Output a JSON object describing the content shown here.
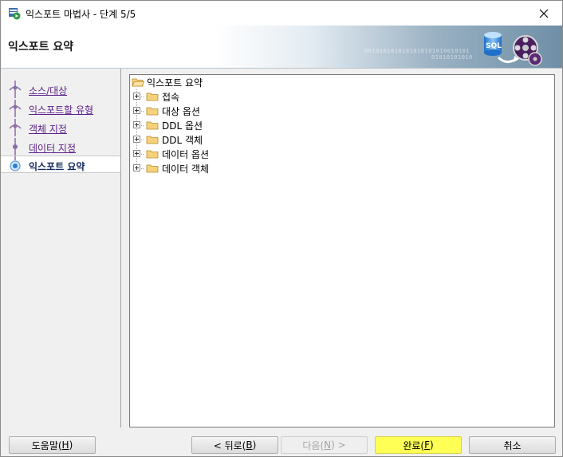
{
  "window": {
    "title": "익스포트 마법사 - 단계 5/5"
  },
  "banner": {
    "title": "익스포트 요약",
    "bits": "0010101010101010101010010101",
    "bits2": "01010101010",
    "graphic_text": "SQL"
  },
  "nav": {
    "items": [
      {
        "label": "소스/대상",
        "state": "done"
      },
      {
        "label": "익스포트할 유형",
        "state": "done"
      },
      {
        "label": "객체 지정",
        "state": "done"
      },
      {
        "label": "데이터 지정",
        "state": "done"
      },
      {
        "label": "익스포트 요약",
        "state": "active"
      }
    ]
  },
  "tree": {
    "root": {
      "label": "익스포트 요약",
      "icon": "open-folder-icon"
    },
    "children": [
      {
        "label": "접속",
        "icon": "folder-icon"
      },
      {
        "label": "대상 옵션",
        "icon": "folder-icon"
      },
      {
        "label": "DDL 옵션",
        "icon": "folder-icon"
      },
      {
        "label": "DDL 객체",
        "icon": "folder-icon"
      },
      {
        "label": "데이터 옵션",
        "icon": "folder-icon"
      },
      {
        "label": "데이터 객체",
        "icon": "folder-icon"
      }
    ]
  },
  "buttons": {
    "help": {
      "label": "도움말(",
      "mnemonic": "H",
      "tail": ")"
    },
    "back": {
      "label": "< 뒤로(",
      "mnemonic": "B",
      "tail": ")"
    },
    "next": {
      "label": "다음(",
      "mnemonic": "N",
      "tail": ") >"
    },
    "finish": {
      "label": "완료(",
      "mnemonic": "F",
      "tail": ")"
    },
    "cancel": {
      "label": "취소"
    }
  },
  "colors": {
    "nav_link": "#5b1f8a",
    "nav_active": "#12295c",
    "finish_highlight": "#ffff55"
  }
}
